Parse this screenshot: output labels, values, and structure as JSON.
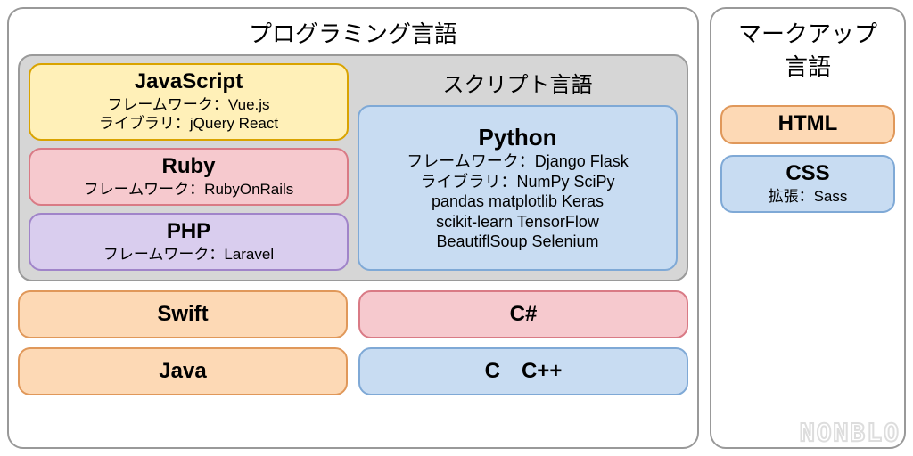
{
  "programming": {
    "title": "プログラミング言語",
    "script_group_title": "スクリプト言語",
    "script_left": [
      {
        "key": "javascript",
        "name": "JavaScript",
        "lines": [
          "フレームワーク：Vue.js",
          "ライブラリ：jQuery React"
        ],
        "color": "c-yellow"
      },
      {
        "key": "ruby",
        "name": "Ruby",
        "lines": [
          "フレームワーク：RubyOnRails"
        ],
        "color": "c-pink"
      },
      {
        "key": "php",
        "name": "PHP",
        "lines": [
          "フレームワーク：Laravel"
        ],
        "color": "c-purple"
      }
    ],
    "python": {
      "name": "Python",
      "lines": [
        "フレームワーク：Django Flask",
        "ライブラリ：NumPy SciPy",
        "pandas matplotlib Keras",
        "scikit-learn TensorFlow",
        "BeautiflSoup Selenium"
      ]
    },
    "rows": [
      [
        {
          "key": "swift",
          "name": "Swift",
          "color": "c-orange"
        },
        {
          "key": "csharp",
          "name": "C#",
          "color": "c-pink"
        }
      ],
      [
        {
          "key": "java",
          "name": "Java",
          "color": "c-orange"
        },
        {
          "key": "c-cpp",
          "name": "C　C++",
          "color": "c-blue"
        }
      ]
    ]
  },
  "markup": {
    "title": "マークアップ\n言語",
    "cards": [
      {
        "key": "html",
        "name": "HTML",
        "lines": [],
        "color": "c-orange"
      },
      {
        "key": "css",
        "name": "CSS",
        "lines": [
          "拡張：Sass"
        ],
        "color": "c-blue"
      }
    ]
  },
  "watermark": "NONBLO"
}
